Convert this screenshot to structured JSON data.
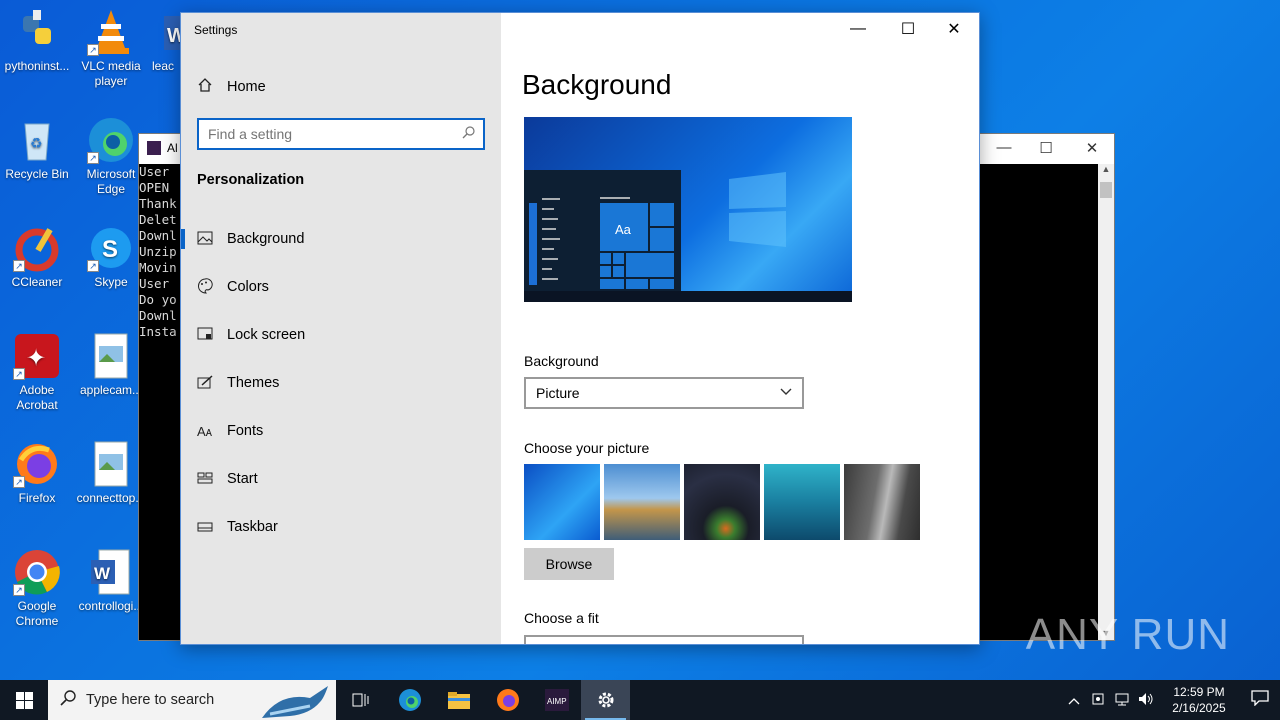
{
  "desktop": {
    "icons": [
      {
        "label": "pythoninst..."
      },
      {
        "label": "VLC media player"
      },
      {
        "label": "leac"
      },
      {
        "label": "Recycle Bin"
      },
      {
        "label": "Microsoft Edge"
      },
      {
        "label": "CCleaner"
      },
      {
        "label": "Skype"
      },
      {
        "label": "Adobe Acrobat"
      },
      {
        "label": "applecam..."
      },
      {
        "label": "Firefox"
      },
      {
        "label": "connecttop..."
      },
      {
        "label": "Google Chrome"
      },
      {
        "label": "controllogi..."
      }
    ]
  },
  "console": {
    "title": "Al",
    "lines": [
      "User",
      "OPEN",
      "Thank",
      "Delet",
      "Downl",
      "Unzip",
      "Movin",
      "User",
      "Do yo",
      "Downl",
      "Insta"
    ]
  },
  "settings": {
    "window_title": "Settings",
    "controls": {
      "minimize": "—",
      "maximize": "☐",
      "close": "✕"
    },
    "home_label": "Home",
    "search_placeholder": "Find a setting",
    "section_title": "Personalization",
    "nav": [
      {
        "label": "Background",
        "icon": "picture-icon",
        "active": true
      },
      {
        "label": "Colors",
        "icon": "palette-icon"
      },
      {
        "label": "Lock screen",
        "icon": "lock-screen-icon"
      },
      {
        "label": "Themes",
        "icon": "brush-icon"
      },
      {
        "label": "Fonts",
        "icon": "fonts-icon"
      },
      {
        "label": "Start",
        "icon": "start-icon"
      },
      {
        "label": "Taskbar",
        "icon": "taskbar-icon"
      }
    ],
    "page_title": "Background",
    "preview_tile_text": "Aa",
    "background_label": "Background",
    "background_value": "Picture",
    "choose_picture_label": "Choose your picture",
    "browse_label": "Browse",
    "choose_fit_label": "Choose a fit"
  },
  "watermark": "ANY RUN",
  "taskbar": {
    "search_placeholder": "Type here to search",
    "apps": [
      "task-view-icon",
      "edge-icon",
      "file-explorer-icon",
      "firefox-icon",
      "aimp-icon",
      "settings-icon"
    ],
    "time": "12:59 PM",
    "date": "2/16/2025"
  },
  "colors": {
    "accent": "#0a64c8",
    "desktop": "#0b74e0",
    "taskbar": "#101823"
  }
}
